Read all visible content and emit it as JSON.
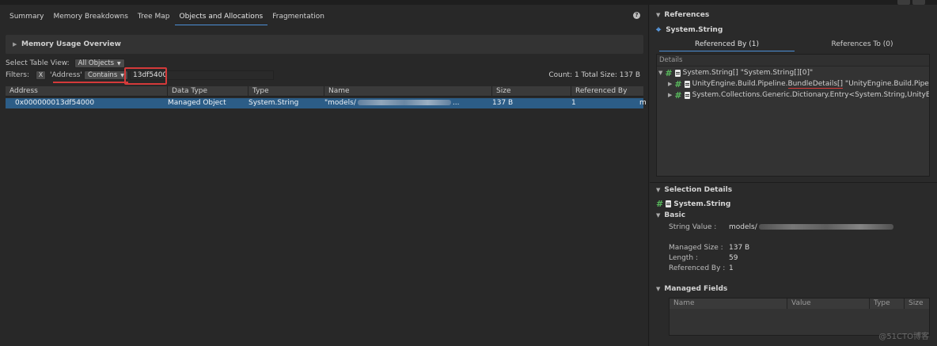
{
  "tabs": [
    "Summary",
    "Memory Breakdowns",
    "Tree Map",
    "Objects and Allocations",
    "Fragmentation"
  ],
  "active_tab": "Objects and Allocations",
  "overview_label": "Memory Usage Overview",
  "table_view": {
    "label": "Select Table View:",
    "value": "All Objects"
  },
  "filters": {
    "label": "Filters:",
    "remove": "X",
    "field": "'Address'",
    "operator": "Contains",
    "value": "13df5400",
    "count": "Count: 1  Total Size: 137 B"
  },
  "columns": [
    "Address",
    "Data Type",
    "Type",
    "Name",
    "Size",
    "Referenced By"
  ],
  "rows": [
    {
      "address": "0x000000013df54000",
      "data_type": "Managed Object",
      "type": "System.String",
      "name_start": "\"models/",
      "name_end": "...",
      "size": "137 B",
      "referenced_by": "1"
    }
  ],
  "references": {
    "title": "References",
    "object": "System.String",
    "tabs": [
      "Referenced By (1)",
      "References To (0)"
    ],
    "details_header": "Details",
    "tree": [
      "System.String[] \"System.String[][0]\"",
      "UnityEngine.Build.Pipeline.",
      "BundleDetails[]",
      " \"UnityEngine.Build.Pipeline.",
      "System.Collections.Generic.Dictionary.Entry<System.String,UnityEngin"
    ]
  },
  "selection": {
    "title": "Selection Details",
    "object": "System.String",
    "basic": "Basic",
    "fields": [
      {
        "key": "String Value :",
        "value": "models/"
      },
      {
        "key": "Managed Size :",
        "value": "137 B"
      },
      {
        "key": "Length :",
        "value": "59"
      },
      {
        "key": "Referenced By :",
        "value": "1"
      }
    ],
    "managed_fields": "Managed Fields",
    "mf_columns": [
      "Name",
      "Value",
      "Type",
      "Size"
    ]
  },
  "watermark": "@51CTO博客"
}
